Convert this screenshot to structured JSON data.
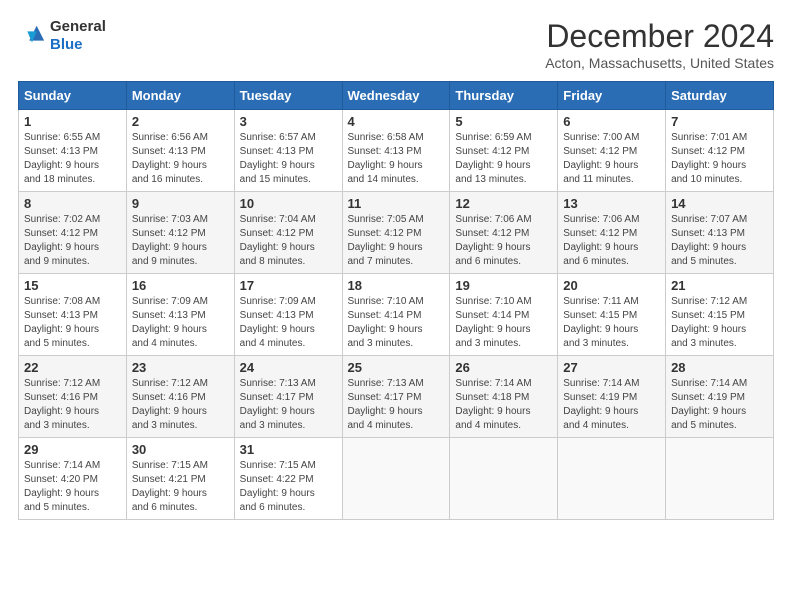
{
  "header": {
    "logo_line1": "General",
    "logo_line2": "Blue",
    "title": "December 2024",
    "location": "Acton, Massachusetts, United States"
  },
  "weekdays": [
    "Sunday",
    "Monday",
    "Tuesday",
    "Wednesday",
    "Thursday",
    "Friday",
    "Saturday"
  ],
  "weeks": [
    [
      {
        "day": "1",
        "info": "Sunrise: 6:55 AM\nSunset: 4:13 PM\nDaylight: 9 hours\nand 18 minutes."
      },
      {
        "day": "2",
        "info": "Sunrise: 6:56 AM\nSunset: 4:13 PM\nDaylight: 9 hours\nand 16 minutes."
      },
      {
        "day": "3",
        "info": "Sunrise: 6:57 AM\nSunset: 4:13 PM\nDaylight: 9 hours\nand 15 minutes."
      },
      {
        "day": "4",
        "info": "Sunrise: 6:58 AM\nSunset: 4:13 PM\nDaylight: 9 hours\nand 14 minutes."
      },
      {
        "day": "5",
        "info": "Sunrise: 6:59 AM\nSunset: 4:12 PM\nDaylight: 9 hours\nand 13 minutes."
      },
      {
        "day": "6",
        "info": "Sunrise: 7:00 AM\nSunset: 4:12 PM\nDaylight: 9 hours\nand 11 minutes."
      },
      {
        "day": "7",
        "info": "Sunrise: 7:01 AM\nSunset: 4:12 PM\nDaylight: 9 hours\nand 10 minutes."
      }
    ],
    [
      {
        "day": "8",
        "info": "Sunrise: 7:02 AM\nSunset: 4:12 PM\nDaylight: 9 hours\nand 9 minutes."
      },
      {
        "day": "9",
        "info": "Sunrise: 7:03 AM\nSunset: 4:12 PM\nDaylight: 9 hours\nand 9 minutes."
      },
      {
        "day": "10",
        "info": "Sunrise: 7:04 AM\nSunset: 4:12 PM\nDaylight: 9 hours\nand 8 minutes."
      },
      {
        "day": "11",
        "info": "Sunrise: 7:05 AM\nSunset: 4:12 PM\nDaylight: 9 hours\nand 7 minutes."
      },
      {
        "day": "12",
        "info": "Sunrise: 7:06 AM\nSunset: 4:12 PM\nDaylight: 9 hours\nand 6 minutes."
      },
      {
        "day": "13",
        "info": "Sunrise: 7:06 AM\nSunset: 4:12 PM\nDaylight: 9 hours\nand 6 minutes."
      },
      {
        "day": "14",
        "info": "Sunrise: 7:07 AM\nSunset: 4:13 PM\nDaylight: 9 hours\nand 5 minutes."
      }
    ],
    [
      {
        "day": "15",
        "info": "Sunrise: 7:08 AM\nSunset: 4:13 PM\nDaylight: 9 hours\nand 5 minutes."
      },
      {
        "day": "16",
        "info": "Sunrise: 7:09 AM\nSunset: 4:13 PM\nDaylight: 9 hours\nand 4 minutes."
      },
      {
        "day": "17",
        "info": "Sunrise: 7:09 AM\nSunset: 4:13 PM\nDaylight: 9 hours\nand 4 minutes."
      },
      {
        "day": "18",
        "info": "Sunrise: 7:10 AM\nSunset: 4:14 PM\nDaylight: 9 hours\nand 3 minutes."
      },
      {
        "day": "19",
        "info": "Sunrise: 7:10 AM\nSunset: 4:14 PM\nDaylight: 9 hours\nand 3 minutes."
      },
      {
        "day": "20",
        "info": "Sunrise: 7:11 AM\nSunset: 4:15 PM\nDaylight: 9 hours\nand 3 minutes."
      },
      {
        "day": "21",
        "info": "Sunrise: 7:12 AM\nSunset: 4:15 PM\nDaylight: 9 hours\nand 3 minutes."
      }
    ],
    [
      {
        "day": "22",
        "info": "Sunrise: 7:12 AM\nSunset: 4:16 PM\nDaylight: 9 hours\nand 3 minutes."
      },
      {
        "day": "23",
        "info": "Sunrise: 7:12 AM\nSunset: 4:16 PM\nDaylight: 9 hours\nand 3 minutes."
      },
      {
        "day": "24",
        "info": "Sunrise: 7:13 AM\nSunset: 4:17 PM\nDaylight: 9 hours\nand 3 minutes."
      },
      {
        "day": "25",
        "info": "Sunrise: 7:13 AM\nSunset: 4:17 PM\nDaylight: 9 hours\nand 4 minutes."
      },
      {
        "day": "26",
        "info": "Sunrise: 7:14 AM\nSunset: 4:18 PM\nDaylight: 9 hours\nand 4 minutes."
      },
      {
        "day": "27",
        "info": "Sunrise: 7:14 AM\nSunset: 4:19 PM\nDaylight: 9 hours\nand 4 minutes."
      },
      {
        "day": "28",
        "info": "Sunrise: 7:14 AM\nSunset: 4:19 PM\nDaylight: 9 hours\nand 5 minutes."
      }
    ],
    [
      {
        "day": "29",
        "info": "Sunrise: 7:14 AM\nSunset: 4:20 PM\nDaylight: 9 hours\nand 5 minutes."
      },
      {
        "day": "30",
        "info": "Sunrise: 7:15 AM\nSunset: 4:21 PM\nDaylight: 9 hours\nand 6 minutes."
      },
      {
        "day": "31",
        "info": "Sunrise: 7:15 AM\nSunset: 4:22 PM\nDaylight: 9 hours\nand 6 minutes."
      },
      {
        "day": "",
        "info": ""
      },
      {
        "day": "",
        "info": ""
      },
      {
        "day": "",
        "info": ""
      },
      {
        "day": "",
        "info": ""
      }
    ]
  ]
}
